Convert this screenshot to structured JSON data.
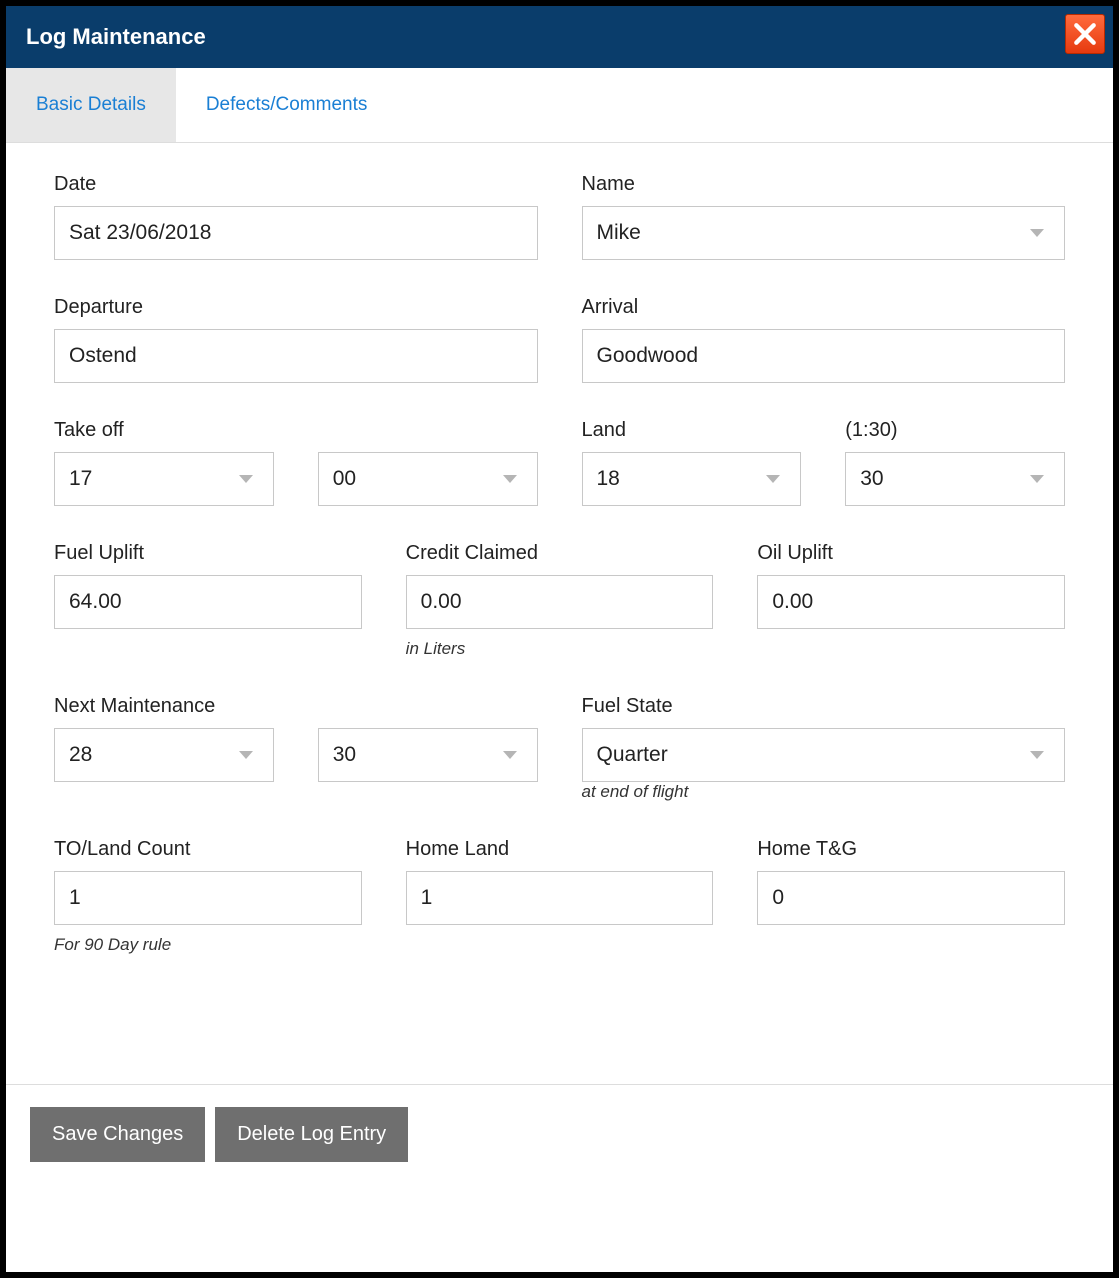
{
  "window": {
    "title": "Log Maintenance"
  },
  "tabs": {
    "basic": "Basic Details",
    "defects": "Defects/Comments"
  },
  "fields": {
    "date": {
      "label": "Date",
      "value": "Sat 23/06/2018"
    },
    "name": {
      "label": "Name",
      "value": "Mike"
    },
    "departure": {
      "label": "Departure",
      "value": "Ostend"
    },
    "arrival": {
      "label": "Arrival",
      "value": "Goodwood"
    },
    "takeoff": {
      "label": "Take off",
      "hour": "17",
      "min": "00"
    },
    "land": {
      "label": "Land",
      "hour": "18",
      "min": "30",
      "duration_label": "(1:30)"
    },
    "fuel_uplift": {
      "label": "Fuel Uplift",
      "value": "64.00"
    },
    "credit_claimed": {
      "label": "Credit Claimed",
      "value": "0.00",
      "hint": "in Liters"
    },
    "oil_uplift": {
      "label": "Oil Uplift",
      "value": "0.00"
    },
    "next_maintenance": {
      "label": "Next Maintenance",
      "a": "28",
      "b": "30"
    },
    "fuel_state": {
      "label": "Fuel State",
      "value": "Quarter",
      "hint": "at end of flight"
    },
    "to_land_count": {
      "label": "TO/Land Count",
      "value": "1",
      "hint": "For 90 Day rule"
    },
    "home_land": {
      "label": "Home Land",
      "value": "1"
    },
    "home_tg": {
      "label": "Home T&G",
      "value": "0"
    }
  },
  "buttons": {
    "save": "Save Changes",
    "delete": "Delete Log Entry"
  }
}
